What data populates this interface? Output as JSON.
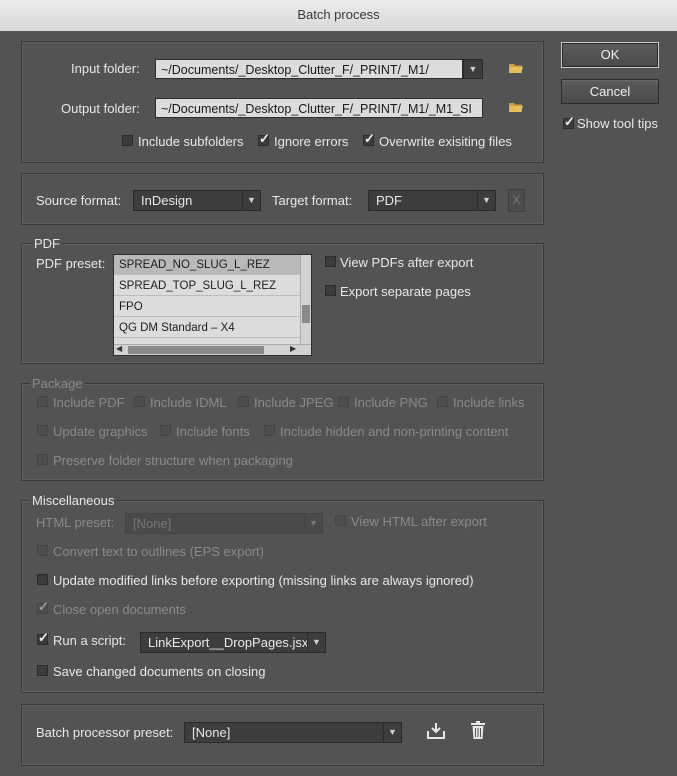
{
  "window": {
    "title": "Batch process"
  },
  "buttons": {
    "ok": "OK",
    "cancel": "Cancel"
  },
  "show_tool_tips": {
    "label": "Show tool tips",
    "checked": true
  },
  "folders": {
    "input_label": "Input folder:",
    "input_value": "~/Documents/_Desktop_Clutter_F/_PRINT/_M1/",
    "output_label": "Output folder:",
    "output_value": "~/Documents/_Desktop_Clutter_F/_PRINT/_M1/_M1_SI",
    "include_subfolders": "Include subfolders",
    "ignore_errors": "Ignore errors",
    "overwrite": "Overwrite exisiting files"
  },
  "formats": {
    "source_label": "Source format:",
    "source_value": "InDesign",
    "target_label": "Target format:",
    "target_value": "PDF",
    "x_button": "X"
  },
  "pdf": {
    "legend": "PDF",
    "preset_label": "PDF preset:",
    "presets": [
      "SPREAD_NO_SLUG_L_REZ",
      "SPREAD_TOP_SLUG_L_REZ",
      "FPO",
      "QG DM Standard – X4"
    ],
    "view_after_export": "View PDFs after export",
    "export_separate": "Export separate pages"
  },
  "package": {
    "legend": "Package",
    "include_pdf": "Include PDF",
    "include_idml": "Include IDML",
    "include_jpeg": "Include JPEG",
    "include_png": "Include PNG",
    "include_links": "Include links",
    "update_graphics": "Update graphics",
    "include_fonts": "Include fonts",
    "include_hidden": "Include hidden and non-printing content",
    "preserve_structure": "Preserve folder structure when packaging"
  },
  "misc": {
    "legend": "Miscellaneous",
    "html_preset_label": "HTML preset:",
    "html_preset_value": "[None]",
    "view_html": "View HTML after export",
    "convert_outlines": "Convert text to outlines (EPS export)",
    "update_links": "Update modified links before exporting (missing links are always ignored)",
    "close_docs": "Close open documents",
    "run_script": "Run a script:",
    "script_value": "LinkExport__DropPages.jsx",
    "save_changed": "Save changed documents on closing"
  },
  "preset": {
    "label": "Batch processor preset:",
    "value": "[None]"
  }
}
